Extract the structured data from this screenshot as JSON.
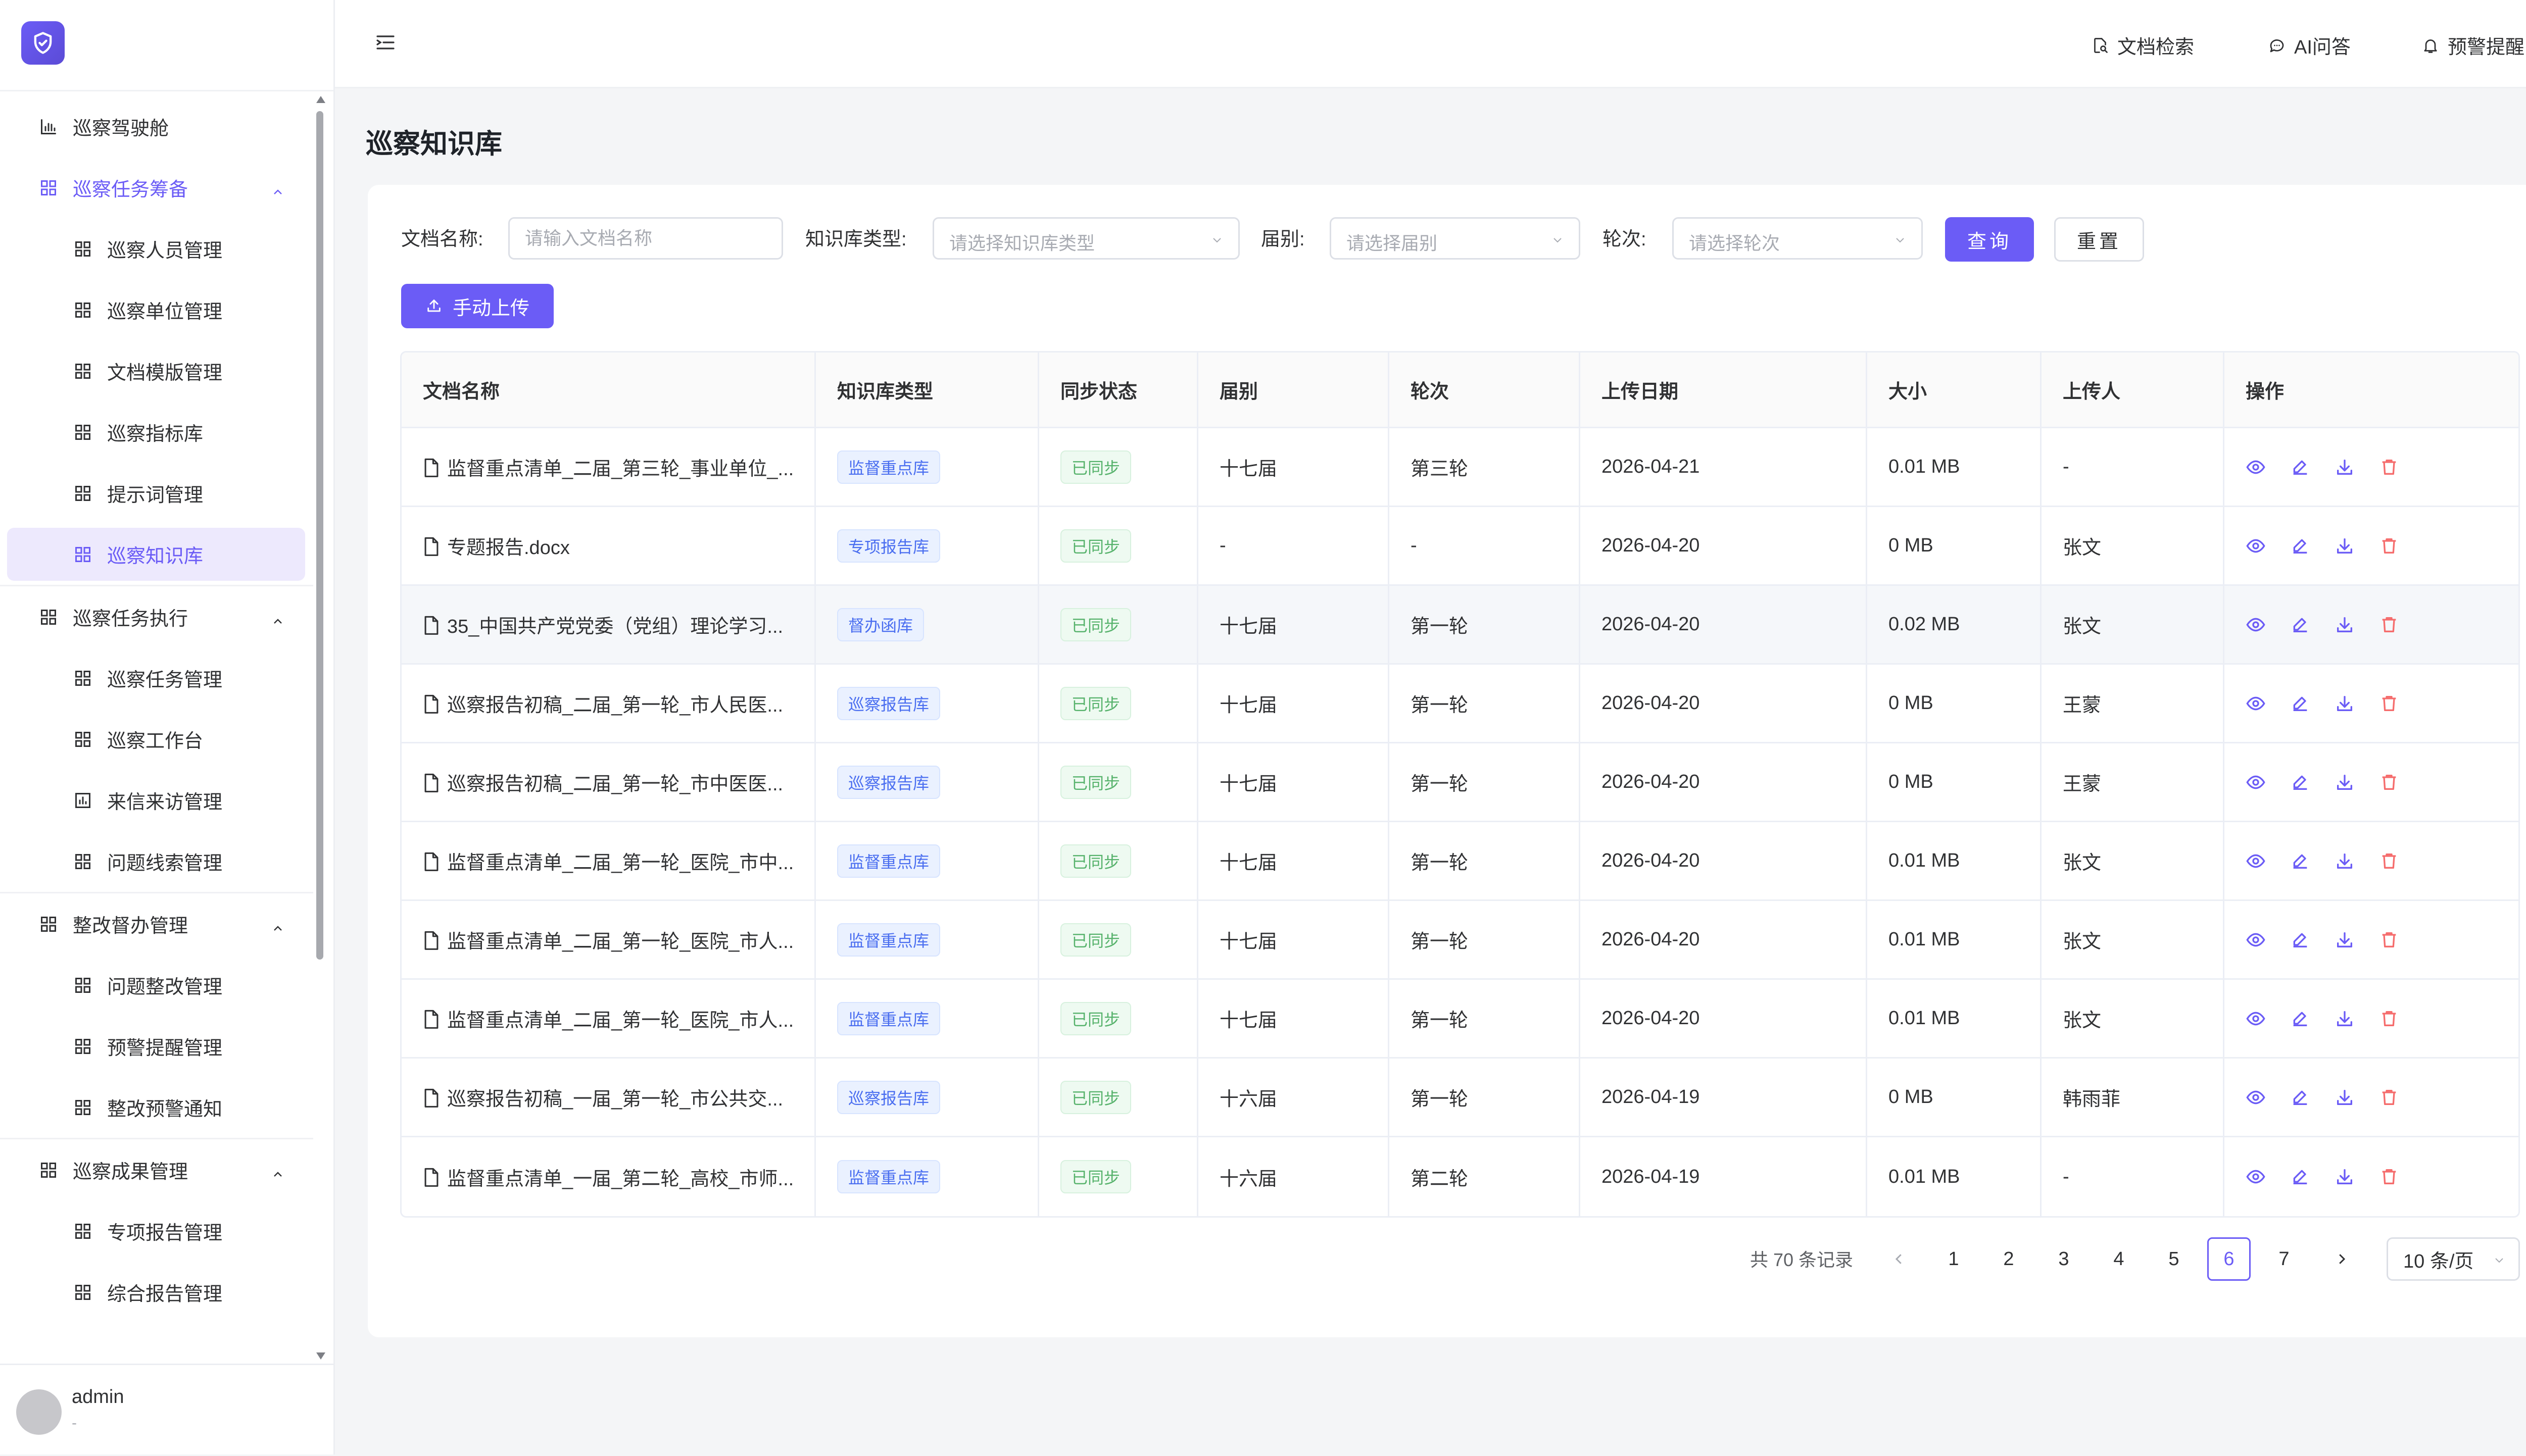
{
  "topbar": {
    "actions": [
      {
        "label": "文档检索",
        "icon": "document-search-icon"
      },
      {
        "label": "AI问答",
        "icon": "chat-icon"
      },
      {
        "label": "预警提醒",
        "icon": "bell-icon"
      }
    ]
  },
  "sidebar": {
    "dashboard": {
      "label": "巡察驾驶舱",
      "icon": "bar-chart-icon"
    },
    "groups": [
      {
        "label": "巡察任务筹备",
        "items": [
          "巡察人员管理",
          "巡察单位管理",
          "文档模版管理",
          "巡察指标库",
          "提示词管理",
          "巡察知识库"
        ]
      },
      {
        "label": "巡察任务执行",
        "items": [
          "巡察任务管理",
          "巡察工作台",
          "来信来访管理",
          "问题线索管理"
        ]
      },
      {
        "label": "整改督办管理",
        "items": [
          "问题整改管理",
          "预警提醒管理",
          "整改预警通知"
        ]
      },
      {
        "label": "巡察成果管理",
        "items": [
          "专项报告管理",
          "综合报告管理"
        ]
      }
    ],
    "active_item": "巡察知识库",
    "user": {
      "name": "admin",
      "role": "-"
    }
  },
  "page": {
    "title": "巡察知识库"
  },
  "filters": {
    "name_label": "文档名称:",
    "name_placeholder": "请输入文档名称",
    "type_label": "知识库类型:",
    "type_placeholder": "请选择知识库类型",
    "session_label": "届别:",
    "session_placeholder": "请选择届别",
    "round_label": "轮次:",
    "round_placeholder": "请选择轮次",
    "query_label": "查询",
    "reset_label": "重置",
    "upload_label": "手动上传"
  },
  "table": {
    "headers": [
      "文档名称",
      "知识库类型",
      "同步状态",
      "届别",
      "轮次",
      "上传日期",
      "大小",
      "上传人",
      "操作"
    ],
    "rows": [
      {
        "name": "监督重点清单_二届_第三轮_事业单位_...",
        "type": "监督重点库",
        "status": "已同步",
        "session": "十七届",
        "round": "第三轮",
        "date": "2026-04-21",
        "size": "0.01 MB",
        "uploader": "-"
      },
      {
        "name": "专题报告.docx",
        "type": "专项报告库",
        "status": "已同步",
        "session": "-",
        "round": "-",
        "date": "2026-04-20",
        "size": "0 MB",
        "uploader": "张文"
      },
      {
        "name": "35_中国共产党党委（党组）理论学习...",
        "type": "督办函库",
        "status": "已同步",
        "session": "十七届",
        "round": "第一轮",
        "date": "2026-04-20",
        "size": "0.02 MB",
        "uploader": "张文"
      },
      {
        "name": "巡察报告初稿_二届_第一轮_市人民医...",
        "type": "巡察报告库",
        "status": "已同步",
        "session": "十七届",
        "round": "第一轮",
        "date": "2026-04-20",
        "size": "0 MB",
        "uploader": "王蒙"
      },
      {
        "name": "巡察报告初稿_二届_第一轮_市中医医...",
        "type": "巡察报告库",
        "status": "已同步",
        "session": "十七届",
        "round": "第一轮",
        "date": "2026-04-20",
        "size": "0 MB",
        "uploader": "王蒙"
      },
      {
        "name": "监督重点清单_二届_第一轮_医院_市中...",
        "type": "监督重点库",
        "status": "已同步",
        "session": "十七届",
        "round": "第一轮",
        "date": "2026-04-20",
        "size": "0.01 MB",
        "uploader": "张文"
      },
      {
        "name": "监督重点清单_二届_第一轮_医院_市人...",
        "type": "监督重点库",
        "status": "已同步",
        "session": "十七届",
        "round": "第一轮",
        "date": "2026-04-20",
        "size": "0.01 MB",
        "uploader": "张文"
      },
      {
        "name": "监督重点清单_二届_第一轮_医院_市人...",
        "type": "监督重点库",
        "status": "已同步",
        "session": "十七届",
        "round": "第一轮",
        "date": "2026-04-20",
        "size": "0.01 MB",
        "uploader": "张文"
      },
      {
        "name": "巡察报告初稿_一届_第一轮_市公共交...",
        "type": "巡察报告库",
        "status": "已同步",
        "session": "十六届",
        "round": "第一轮",
        "date": "2026-04-19",
        "size": "0 MB",
        "uploader": "韩雨菲"
      },
      {
        "name": "监督重点清单_一届_第二轮_高校_市师...",
        "type": "监督重点库",
        "status": "已同步",
        "session": "十六届",
        "round": "第二轮",
        "date": "2026-04-19",
        "size": "0.01 MB",
        "uploader": "-"
      }
    ],
    "highlighted_row": 2,
    "row_actions": [
      "view-icon",
      "edit-icon",
      "download-icon",
      "delete-icon"
    ]
  },
  "pagination": {
    "total_text": "共 70 条记录",
    "pages": [
      "1",
      "2",
      "3",
      "4",
      "5",
      "6",
      "7"
    ],
    "current_page": "6",
    "page_size": "10 条/页"
  },
  "colors": {
    "primary": "#6b5cf6",
    "tag_blue": "#4a6ef0",
    "tag_green": "#56b26b",
    "danger": "#f56c6c"
  }
}
